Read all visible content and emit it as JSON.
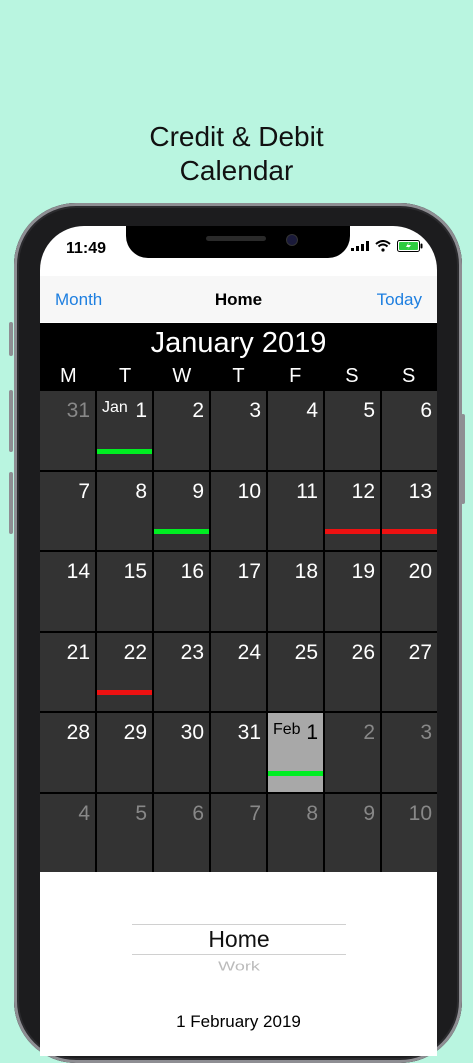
{
  "headline": {
    "line1": "Credit & Debit",
    "line2": "Calendar"
  },
  "status": {
    "time": "11:49"
  },
  "nav": {
    "left": "Month",
    "title": "Home",
    "right": "Today"
  },
  "calendar": {
    "title": "January 2019",
    "weekdays": [
      "M",
      "T",
      "W",
      "T",
      "F",
      "S",
      "S"
    ],
    "cells": [
      {
        "day": "31",
        "dim": true
      },
      {
        "day": "1",
        "month": "Jan",
        "bar": "green"
      },
      {
        "day": "2"
      },
      {
        "day": "3"
      },
      {
        "day": "4"
      },
      {
        "day": "5"
      },
      {
        "day": "6"
      },
      {
        "day": "7"
      },
      {
        "day": "8"
      },
      {
        "day": "9",
        "bar": "green"
      },
      {
        "day": "10"
      },
      {
        "day": "11"
      },
      {
        "day": "12",
        "bar": "red"
      },
      {
        "day": "13",
        "bar": "red"
      },
      {
        "day": "14"
      },
      {
        "day": "15"
      },
      {
        "day": "16"
      },
      {
        "day": "17"
      },
      {
        "day": "18"
      },
      {
        "day": "19"
      },
      {
        "day": "20"
      },
      {
        "day": "21"
      },
      {
        "day": "22",
        "bar": "red"
      },
      {
        "day": "23"
      },
      {
        "day": "24"
      },
      {
        "day": "25"
      },
      {
        "day": "26"
      },
      {
        "day": "27"
      },
      {
        "day": "28"
      },
      {
        "day": "29"
      },
      {
        "day": "30"
      },
      {
        "day": "31"
      },
      {
        "day": "1",
        "month": "Feb",
        "bar": "green",
        "selected": true
      },
      {
        "day": "2",
        "dim": true
      },
      {
        "day": "3",
        "dim": true
      },
      {
        "day": "4",
        "dim": true
      },
      {
        "day": "5",
        "dim": true
      },
      {
        "day": "6",
        "dim": true
      },
      {
        "day": "7",
        "dim": true
      },
      {
        "day": "8",
        "dim": true
      },
      {
        "day": "9",
        "dim": true
      },
      {
        "day": "10",
        "dim": true
      }
    ]
  },
  "picker": {
    "selected": "Home",
    "next": "Work"
  },
  "selected_date": "1 February 2019",
  "colors": {
    "background": "#b9f5e0",
    "accent": "#1e7fe0",
    "credit": "#00ee22",
    "debit": "#ee1111"
  }
}
